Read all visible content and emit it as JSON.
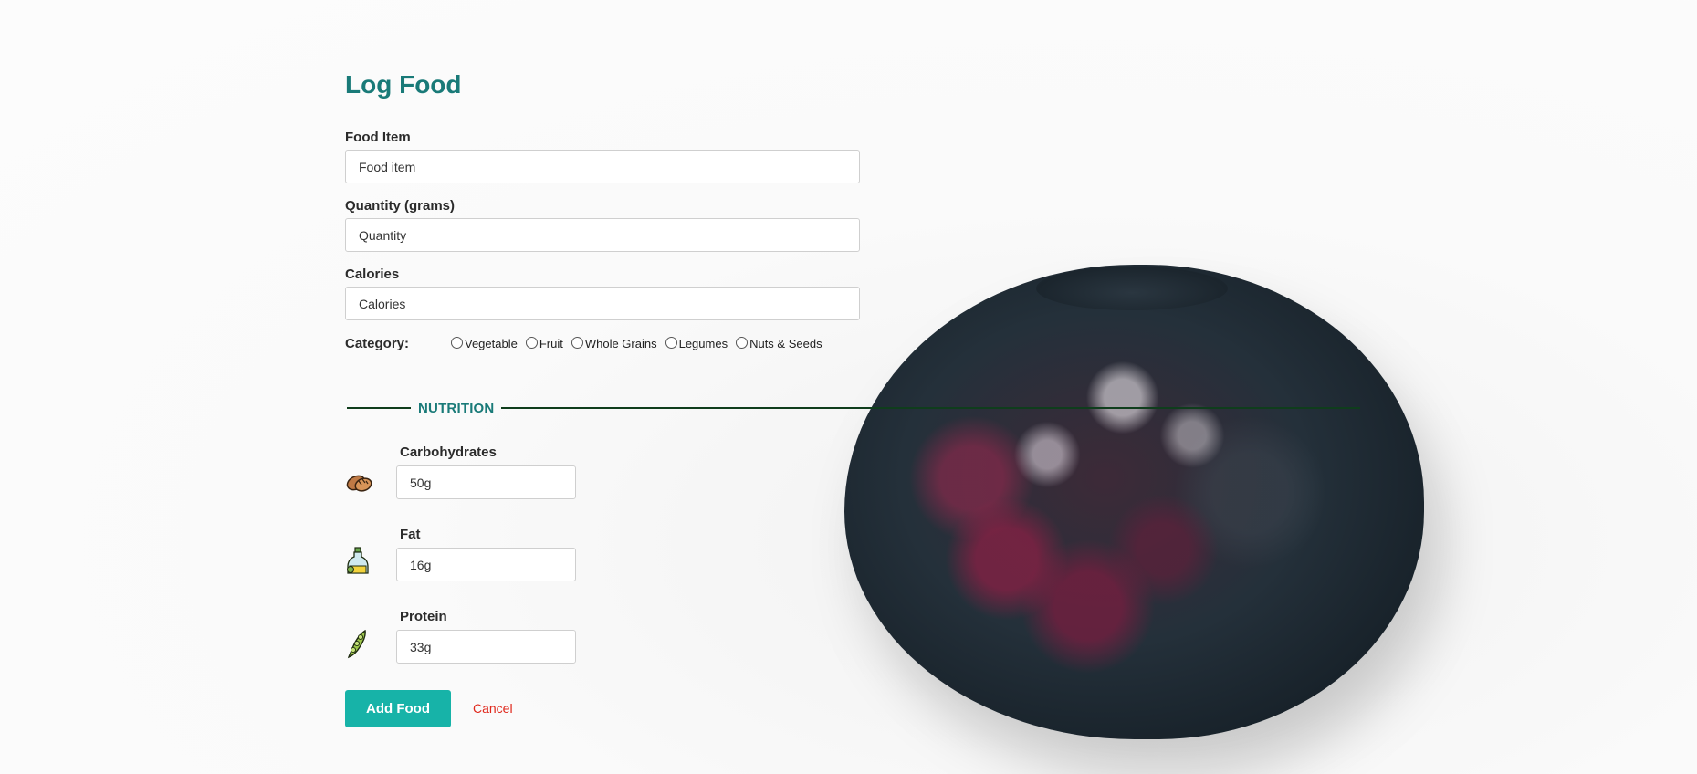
{
  "page": {
    "title": "Log Food"
  },
  "fields": {
    "food_item": {
      "label": "Food Item",
      "placeholder": "Food item",
      "value": ""
    },
    "quantity": {
      "label": "Quantity (grams)",
      "placeholder": "Quantity",
      "value": ""
    },
    "calories": {
      "label": "Calories",
      "placeholder": "Calories",
      "value": ""
    }
  },
  "category": {
    "label": "Category:",
    "options": [
      "Vegetable",
      "Fruit",
      "Whole Grains",
      "Legumes",
      "Nuts & Seeds"
    ],
    "selected": null
  },
  "nutrition": {
    "section_title": "NUTRITION",
    "items": [
      {
        "label": "Carbohydrates",
        "value": "50g",
        "icon": "bread-icon"
      },
      {
        "label": "Fat",
        "value": "16g",
        "icon": "oil-bottle-icon"
      },
      {
        "label": "Protein",
        "value": "33g",
        "icon": "edamame-pod-icon"
      }
    ]
  },
  "actions": {
    "add_label": "Add Food",
    "cancel_label": "Cancel"
  },
  "colors": {
    "title": "#197a78",
    "button": "#17b3a8",
    "cancel": "#e0281c",
    "divider": "#0f3d1c"
  },
  "background_image": "blueberry-with-sugar-crystals"
}
